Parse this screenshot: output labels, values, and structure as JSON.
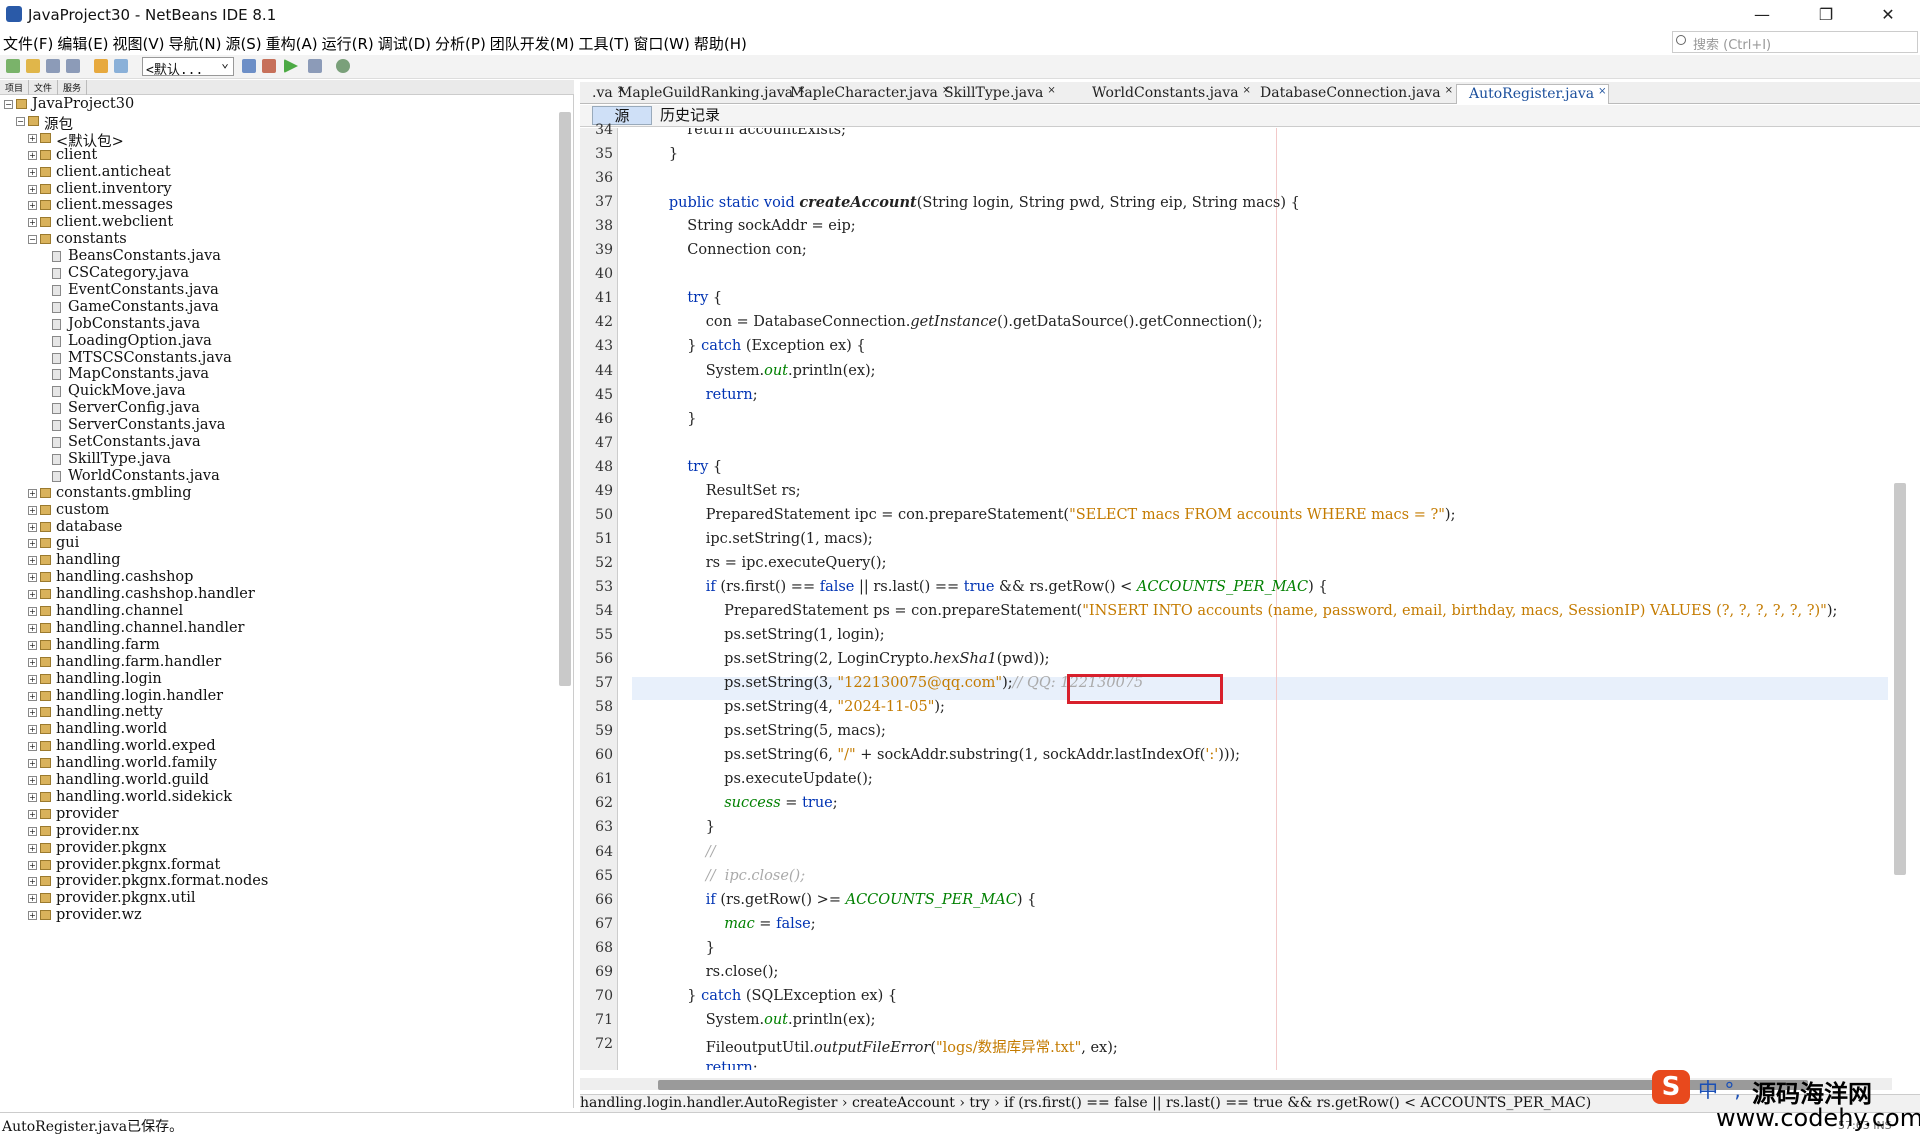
{
  "window": {
    "title": "JavaProject30 - NetBeans IDE 8.1",
    "minimize": "—",
    "restore": "❐",
    "close": "✕"
  },
  "menu": [
    "文件(F)",
    "编辑(E)",
    "视图(V)",
    "导航(N)",
    "源(S)",
    "重构(A)",
    "运行(R)",
    "调试(D)",
    "分析(P)",
    "团队开发(M)",
    "工具(T)",
    "窗口(W)",
    "帮助(H)"
  ],
  "search": {
    "placeholder": "搜索 (Ctrl+I)"
  },
  "toolbar": {
    "config": "<默认..."
  },
  "left_tabs": [
    "项目",
    "文件",
    "服务"
  ],
  "tree": [
    {
      "label": "JavaProject30",
      "level": 0,
      "kind": "project",
      "expanded": true
    },
    {
      "label": "源包",
      "level": 1,
      "kind": "folder",
      "expanded": true
    },
    {
      "label": "<默认包>",
      "level": 2,
      "kind": "pkg"
    },
    {
      "label": "client",
      "level": 2,
      "kind": "pkg"
    },
    {
      "label": "client.anticheat",
      "level": 2,
      "kind": "pkg"
    },
    {
      "label": "client.inventory",
      "level": 2,
      "kind": "pkg"
    },
    {
      "label": "client.messages",
      "level": 2,
      "kind": "pkg"
    },
    {
      "label": "client.webclient",
      "level": 2,
      "kind": "pkg"
    },
    {
      "label": "constants",
      "level": 2,
      "kind": "pkg",
      "expanded": true
    },
    {
      "label": "BeansConstants.java",
      "level": 3,
      "kind": "file"
    },
    {
      "label": "CSCategory.java",
      "level": 3,
      "kind": "file"
    },
    {
      "label": "EventConstants.java",
      "level": 3,
      "kind": "file"
    },
    {
      "label": "GameConstants.java",
      "level": 3,
      "kind": "file"
    },
    {
      "label": "JobConstants.java",
      "level": 3,
      "kind": "file"
    },
    {
      "label": "LoadingOption.java",
      "level": 3,
      "kind": "file"
    },
    {
      "label": "MTSCSConstants.java",
      "level": 3,
      "kind": "file"
    },
    {
      "label": "MapConstants.java",
      "level": 3,
      "kind": "file"
    },
    {
      "label": "QuickMove.java",
      "level": 3,
      "kind": "file"
    },
    {
      "label": "ServerConfig.java",
      "level": 3,
      "kind": "file"
    },
    {
      "label": "ServerConstants.java",
      "level": 3,
      "kind": "file"
    },
    {
      "label": "SetConstants.java",
      "level": 3,
      "kind": "file"
    },
    {
      "label": "SkillType.java",
      "level": 3,
      "kind": "file"
    },
    {
      "label": "WorldConstants.java",
      "level": 3,
      "kind": "file"
    },
    {
      "label": "constants.gmbling",
      "level": 2,
      "kind": "pkg"
    },
    {
      "label": "custom",
      "level": 2,
      "kind": "pkg"
    },
    {
      "label": "database",
      "level": 2,
      "kind": "pkg"
    },
    {
      "label": "gui",
      "level": 2,
      "kind": "pkg"
    },
    {
      "label": "handling",
      "level": 2,
      "kind": "pkg"
    },
    {
      "label": "handling.cashshop",
      "level": 2,
      "kind": "pkg"
    },
    {
      "label": "handling.cashshop.handler",
      "level": 2,
      "kind": "pkg"
    },
    {
      "label": "handling.channel",
      "level": 2,
      "kind": "pkg"
    },
    {
      "label": "handling.channel.handler",
      "level": 2,
      "kind": "pkg"
    },
    {
      "label": "handling.farm",
      "level": 2,
      "kind": "pkg"
    },
    {
      "label": "handling.farm.handler",
      "level": 2,
      "kind": "pkg"
    },
    {
      "label": "handling.login",
      "level": 2,
      "kind": "pkg"
    },
    {
      "label": "handling.login.handler",
      "level": 2,
      "kind": "pkg"
    },
    {
      "label": "handling.netty",
      "level": 2,
      "kind": "pkg"
    },
    {
      "label": "handling.world",
      "level": 2,
      "kind": "pkg"
    },
    {
      "label": "handling.world.exped",
      "level": 2,
      "kind": "pkg"
    },
    {
      "label": "handling.world.family",
      "level": 2,
      "kind": "pkg"
    },
    {
      "label": "handling.world.guild",
      "level": 2,
      "kind": "pkg"
    },
    {
      "label": "handling.world.sidekick",
      "level": 2,
      "kind": "pkg"
    },
    {
      "label": "provider",
      "level": 2,
      "kind": "pkg"
    },
    {
      "label": "provider.nx",
      "level": 2,
      "kind": "pkg"
    },
    {
      "label": "provider.pkgnx",
      "level": 2,
      "kind": "pkg"
    },
    {
      "label": "provider.pkgnx.format",
      "level": 2,
      "kind": "pkg"
    },
    {
      "label": "provider.pkgnx.format.nodes",
      "level": 2,
      "kind": "pkg"
    },
    {
      "label": "provider.pkgnx.util",
      "level": 2,
      "kind": "pkg"
    },
    {
      "label": "provider.wz",
      "level": 2,
      "kind": "pkg"
    }
  ],
  "editor_tabs": [
    {
      "label": ".va",
      "active": false
    },
    {
      "label": "MapleGuildRanking.java",
      "active": false
    },
    {
      "label": "MapleCharacter.java",
      "active": false
    },
    {
      "label": "SkillType.java",
      "active": false
    },
    {
      "label": "WorldConstants.java",
      "active": false
    },
    {
      "label": "DatabaseConnection.java",
      "active": false
    },
    {
      "label": "AutoRegister.java",
      "active": true
    }
  ],
  "editor_toolbar": {
    "source": "源",
    "history": "历史记录"
  },
  "code": [
    {
      "n": "34",
      "segs": [
        [
          "",
          "            return accountExists;"
        ]
      ]
    },
    {
      "n": "35",
      "segs": [
        [
          "",
          "        }"
        ]
      ]
    },
    {
      "n": "36",
      "segs": [
        [
          "",
          ""
        ]
      ]
    },
    {
      "n": "37",
      "segs": [
        [
          "",
          "        "
        ],
        [
          "kw",
          "public static void "
        ],
        [
          "it bold",
          "createAccount"
        ],
        [
          "",
          "(String login, String pwd, String eip, String macs) {"
        ]
      ]
    },
    {
      "n": "38",
      "segs": [
        [
          "",
          "            String sockAddr = eip;"
        ]
      ]
    },
    {
      "n": "39",
      "segs": [
        [
          "",
          "            Connection con;"
        ]
      ]
    },
    {
      "n": "40",
      "segs": [
        [
          "",
          ""
        ]
      ]
    },
    {
      "n": "41",
      "segs": [
        [
          "",
          "            "
        ],
        [
          "kw",
          "try"
        ],
        [
          "",
          " {"
        ]
      ]
    },
    {
      "n": "42",
      "segs": [
        [
          "",
          "                con = DatabaseConnection."
        ],
        [
          "it",
          "getInstance"
        ],
        [
          "",
          "().getDataSource().getConnection();"
        ]
      ]
    },
    {
      "n": "43",
      "segs": [
        [
          "",
          "            } "
        ],
        [
          "kw",
          "catch"
        ],
        [
          "",
          " (Exception ex) {"
        ]
      ]
    },
    {
      "n": "44",
      "segs": [
        [
          "",
          "                System."
        ],
        [
          "fld",
          "out"
        ],
        [
          "",
          ".println(ex);"
        ]
      ]
    },
    {
      "n": "45",
      "segs": [
        [
          "",
          "                "
        ],
        [
          "kw",
          "return"
        ],
        [
          "",
          ";"
        ]
      ]
    },
    {
      "n": "46",
      "segs": [
        [
          "",
          "            }"
        ]
      ]
    },
    {
      "n": "47",
      "segs": [
        [
          "",
          ""
        ]
      ]
    },
    {
      "n": "48",
      "segs": [
        [
          "",
          "            "
        ],
        [
          "kw",
          "try"
        ],
        [
          "",
          " {"
        ]
      ]
    },
    {
      "n": "49",
      "segs": [
        [
          "",
          "                ResultSet rs;"
        ]
      ]
    },
    {
      "n": "50",
      "segs": [
        [
          "",
          "                PreparedStatement ipc = con.prepareStatement("
        ],
        [
          "str",
          "\"SELECT macs FROM accounts WHERE macs = ?\""
        ],
        [
          "",
          ");"
        ]
      ]
    },
    {
      "n": "51",
      "segs": [
        [
          "",
          "                ipc.setString(1, macs);"
        ]
      ]
    },
    {
      "n": "52",
      "segs": [
        [
          "",
          "                rs = ipc.executeQuery();"
        ]
      ]
    },
    {
      "n": "53",
      "segs": [
        [
          "",
          "                "
        ],
        [
          "kw",
          "if"
        ],
        [
          "",
          " (rs.first() == "
        ],
        [
          "kw",
          "false"
        ],
        [
          "",
          " || rs.last() == "
        ],
        [
          "kw",
          "true"
        ],
        [
          "",
          " && rs.getRow() < "
        ],
        [
          "fld",
          "ACCOUNTS_PER_MAC"
        ],
        [
          "",
          ") {"
        ]
      ]
    },
    {
      "n": "54",
      "segs": [
        [
          "",
          "                    PreparedStatement ps = con.prepareStatement("
        ],
        [
          "str",
          "\"INSERT INTO accounts (name, password, email, birthday, macs, SessionIP) VALUES (?, ?, ?, ?, ?, ?)\""
        ],
        [
          "",
          ");"
        ]
      ]
    },
    {
      "n": "55",
      "segs": [
        [
          "",
          "                    ps.setString(1, login);"
        ]
      ]
    },
    {
      "n": "56",
      "segs": [
        [
          "",
          "                    ps.setString(2, LoginCrypto."
        ],
        [
          "it",
          "hexSha1"
        ],
        [
          "",
          "(pwd));"
        ]
      ]
    },
    {
      "n": "57",
      "segs": [
        [
          "",
          "                    ps.setString(3, "
        ],
        [
          "str",
          "\"122130075@qq.com\""
        ],
        [
          "",
          ");"
        ],
        [
          "cm",
          "// QQ: 122130075"
        ]
      ]
    },
    {
      "n": "58",
      "segs": [
        [
          "",
          "                    ps.setString(4, "
        ],
        [
          "str",
          "\"2024-11-05\""
        ],
        [
          "",
          ");"
        ]
      ]
    },
    {
      "n": "59",
      "segs": [
        [
          "",
          "                    ps.setString(5, macs);"
        ]
      ]
    },
    {
      "n": "60",
      "segs": [
        [
          "",
          "                    ps.setString(6, "
        ],
        [
          "str",
          "\"/\""
        ],
        [
          "",
          " + sockAddr.substring(1, sockAddr.lastIndexOf("
        ],
        [
          "str",
          "':'"
        ],
        [
          "",
          ")));"
        ]
      ]
    },
    {
      "n": "61",
      "segs": [
        [
          "",
          "                    ps.executeUpdate();"
        ]
      ]
    },
    {
      "n": "62",
      "segs": [
        [
          "",
          "                    "
        ],
        [
          "fld",
          "success"
        ],
        [
          "",
          " = "
        ],
        [
          "kw",
          "true"
        ],
        [
          "",
          ";"
        ]
      ]
    },
    {
      "n": "63",
      "segs": [
        [
          "",
          "                }"
        ]
      ]
    },
    {
      "n": "64",
      "segs": [
        [
          "",
          "                "
        ],
        [
          "cm",
          "//"
        ]
      ]
    },
    {
      "n": "65",
      "segs": [
        [
          "",
          "                "
        ],
        [
          "cm",
          "//  ipc.close();"
        ]
      ]
    },
    {
      "n": "66",
      "segs": [
        [
          "",
          "                "
        ],
        [
          "kw",
          "if"
        ],
        [
          "",
          " (rs.getRow() >= "
        ],
        [
          "fld",
          "ACCOUNTS_PER_MAC"
        ],
        [
          "",
          ") {"
        ]
      ]
    },
    {
      "n": "67",
      "segs": [
        [
          "",
          "                    "
        ],
        [
          "fld",
          "mac"
        ],
        [
          "",
          " = "
        ],
        [
          "kw",
          "false"
        ],
        [
          "",
          ";"
        ]
      ]
    },
    {
      "n": "68",
      "segs": [
        [
          "",
          "                }"
        ]
      ]
    },
    {
      "n": "69",
      "segs": [
        [
          "",
          "                rs.close();"
        ]
      ]
    },
    {
      "n": "70",
      "segs": [
        [
          "",
          "            } "
        ],
        [
          "kw",
          "catch"
        ],
        [
          "",
          " (SQLException ex) {"
        ]
      ]
    },
    {
      "n": "71",
      "segs": [
        [
          "",
          "                System."
        ],
        [
          "fld",
          "out"
        ],
        [
          "",
          ".println(ex);"
        ]
      ]
    },
    {
      "n": "72",
      "segs": [
        [
          "",
          "                FileoutputUtil."
        ],
        [
          "it",
          "outputFileError"
        ],
        [
          "",
          "("
        ],
        [
          "str",
          "\"logs/数据库异常.txt\""
        ],
        [
          "",
          ", ex);"
        ]
      ]
    },
    {
      "n": "",
      "segs": [
        [
          "",
          "                "
        ],
        [
          "kw",
          "return"
        ],
        [
          "",
          ";"
        ]
      ]
    }
  ],
  "breadcrumb": "handling.login.handler.AutoRegister › createAccount › try › if (rs.first() == false || rs.last() == true && rs.getRow() < ACCOUNTS_PER_MAC)",
  "status": {
    "text": "AutoRegister.java已保存。",
    "position": "57:63",
    "mode": "INS"
  },
  "watermark": {
    "logo": "S",
    "zh": "中 °,",
    "title": "源码海洋网",
    "url": "www.codehy.com"
  },
  "colors": {
    "keyword": "#0033b3",
    "string": "#c47b00",
    "highlight_box": "#d8202c",
    "active_tab": "#1b4f9c"
  }
}
